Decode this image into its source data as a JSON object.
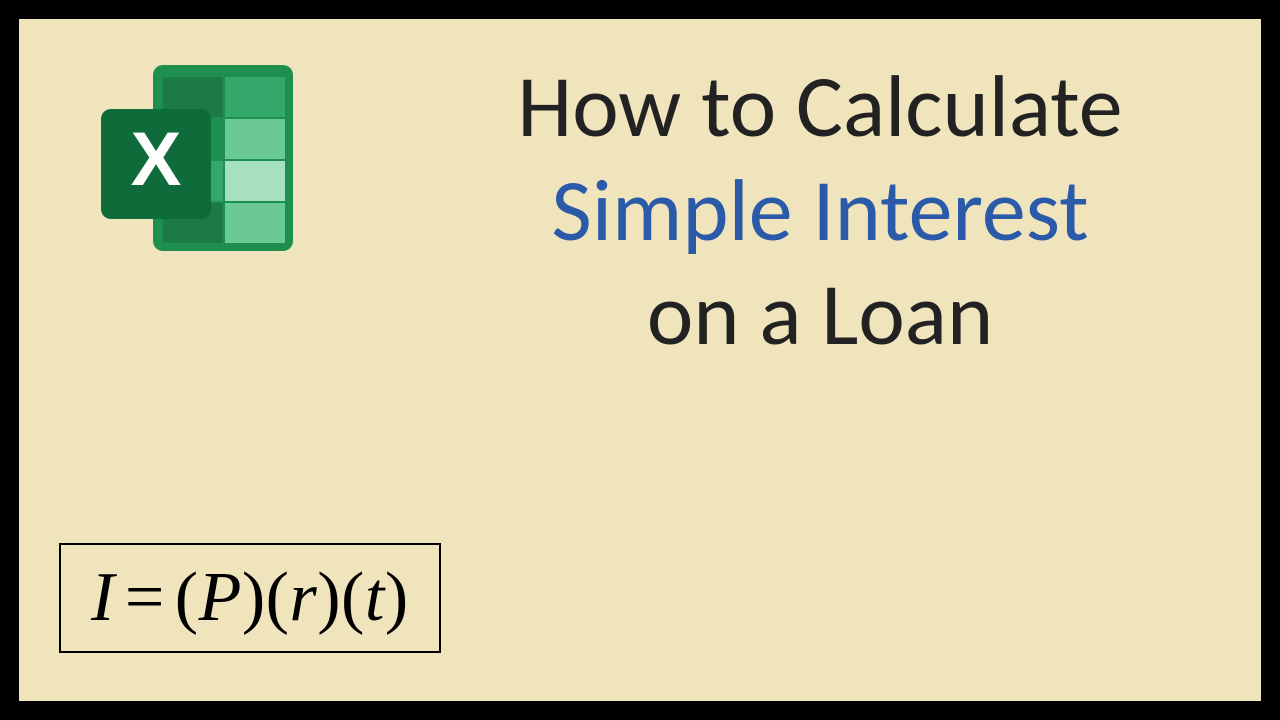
{
  "title": {
    "line1": "How to Calculate",
    "line2": "Simple Interest",
    "line3": "on a Loan"
  },
  "icon": {
    "name": "excel-icon",
    "letter": "X"
  },
  "formula": {
    "lhs": "I",
    "eq": "=",
    "term1": "P",
    "term2": "r",
    "term3": "t"
  },
  "colors": {
    "background": "#f0e4bd",
    "accent": "#2a5aa8",
    "excel_dark": "#0f6b3a",
    "excel_mid": "#1f8f4f",
    "excel_light1": "#33a86a",
    "excel_light2": "#6ac995",
    "excel_pale": "#a7e0bf"
  }
}
